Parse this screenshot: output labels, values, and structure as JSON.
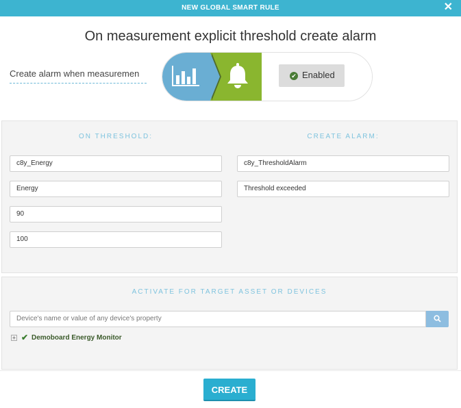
{
  "header": {
    "title": "NEW GLOBAL SMART RULE",
    "close_glyph": "✕"
  },
  "rule": {
    "title": "On measurement explicit threshold create alarm",
    "description": "Create alarm when measuremen",
    "status": "Enabled"
  },
  "threshold": {
    "heading": "ON THRESHOLD:",
    "fields": [
      "c8y_Energy",
      "Energy",
      "90",
      "100"
    ]
  },
  "alarm": {
    "heading": "CREATE ALARM:",
    "fields": [
      "c8y_ThresholdAlarm",
      "Threshold exceeded"
    ]
  },
  "targets": {
    "heading": "ACTIVATE FOR TARGET ASSET OR DEVICES",
    "search_placeholder": "Device's name or value of any device's property",
    "items": [
      {
        "label": "Demoboard Energy Monitor",
        "checked": true
      }
    ]
  },
  "footer": {
    "create_label": "CREATE"
  },
  "colors": {
    "header": "#3db4d0",
    "measurement_step": "#6aaed3",
    "alarm_step": "#8ab62f",
    "primary_button": "#2aaed0"
  }
}
